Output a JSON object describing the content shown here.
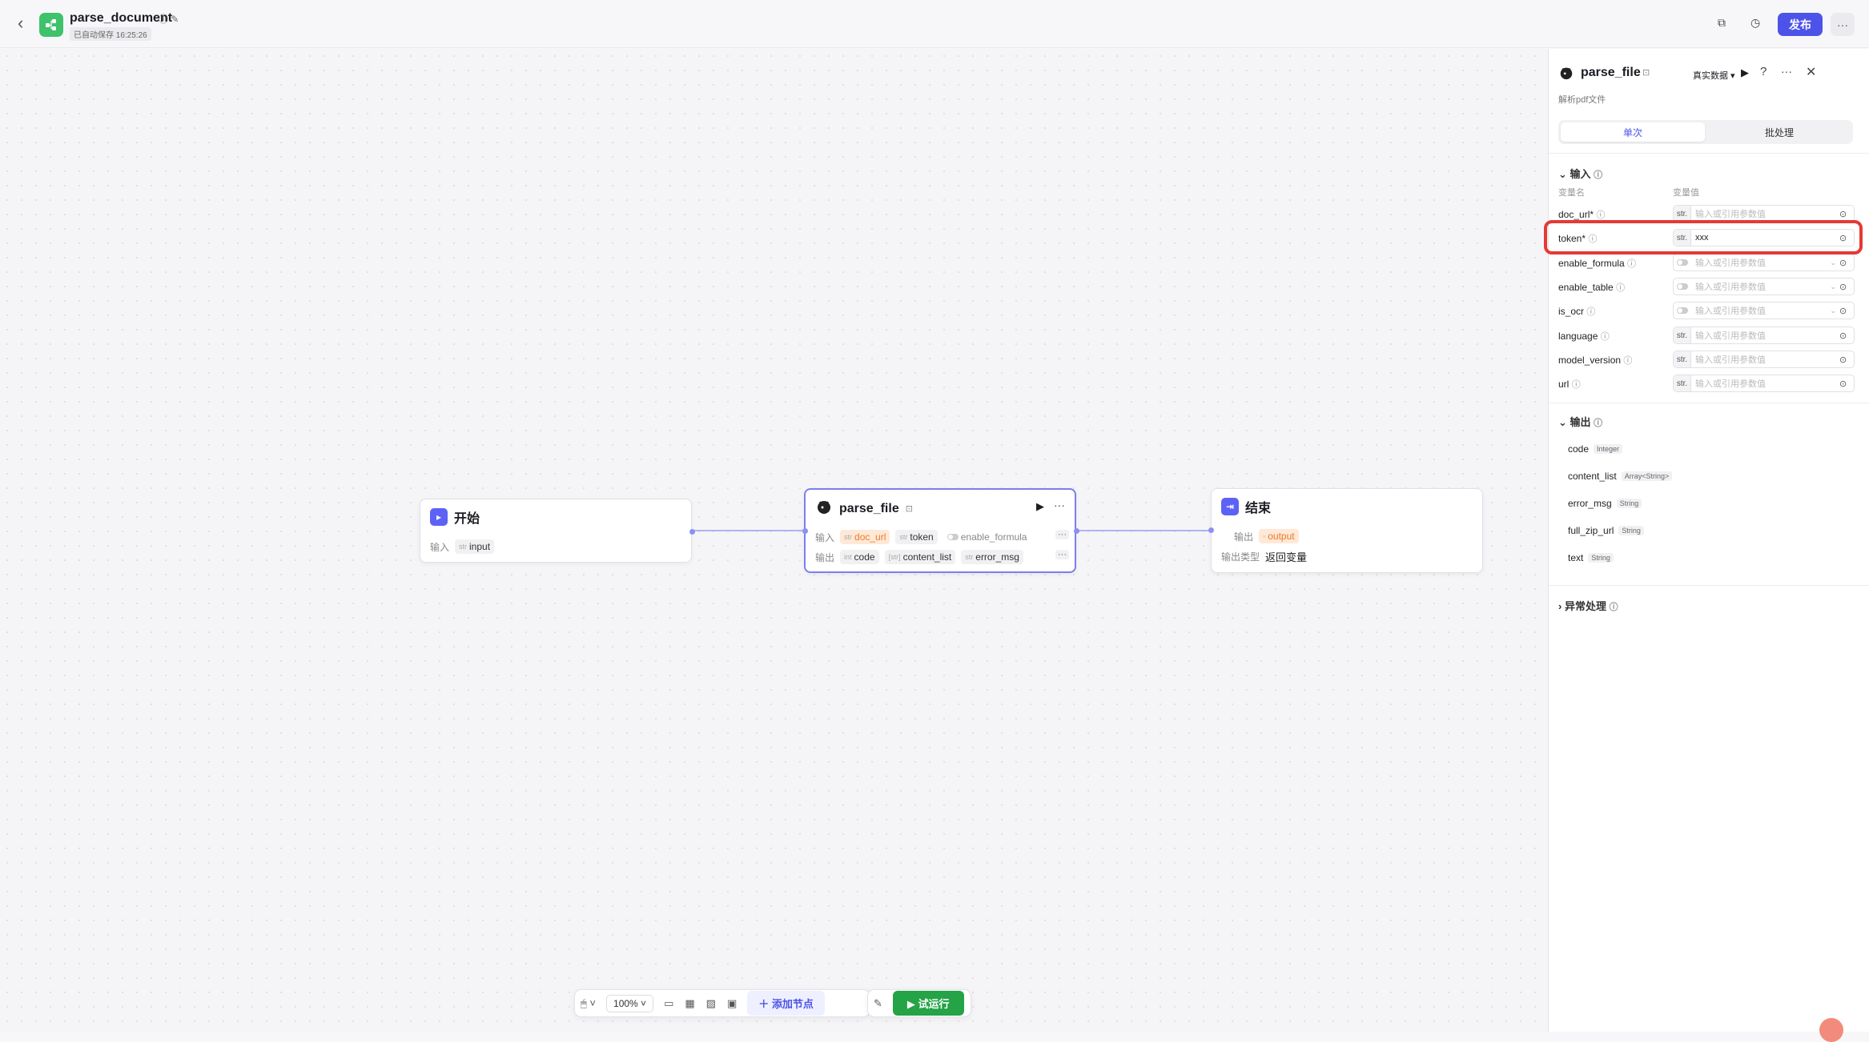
{
  "header": {
    "title": "parse_document",
    "save_status": "已自动保存 16:25:26",
    "publish_label": "发布"
  },
  "canvas": {
    "start_node": {
      "title": "开始",
      "input_label": "输入",
      "input_type": "str",
      "input_value": "input"
    },
    "parse_node": {
      "title": "parse_file",
      "input_label": "输入",
      "inputs": [
        {
          "type": "str",
          "name": "doc_url",
          "style": "orange"
        },
        {
          "type": "str",
          "name": "token",
          "style": "plain"
        },
        {
          "type": "",
          "name": "enable_formula",
          "style": "toggle"
        }
      ],
      "output_label": "输出",
      "outputs": [
        {
          "type": "int",
          "name": "code"
        },
        {
          "type": "[str]",
          "name": "content_list"
        },
        {
          "type": "str",
          "name": "error_msg"
        }
      ]
    },
    "end_node": {
      "title": "结束",
      "output_label": "输出",
      "output_value": "output",
      "output_type_label": "输出类型",
      "output_type_value": "返回变量"
    }
  },
  "toolbar": {
    "zoom": "100%",
    "add_node": "添加节点",
    "test_run": "试运行"
  },
  "panel": {
    "title": "parse_file",
    "data_mode": "真实数据",
    "subtitle": "解析pdf文件",
    "tab_single": "单次",
    "tab_batch": "批处理",
    "input_section": "输入",
    "col_name": "变量名",
    "col_value": "变量值",
    "placeholder": "输入或引用参数值",
    "params": [
      {
        "name": "doc_url",
        "required": true,
        "kind": "str",
        "value": ""
      },
      {
        "name": "token",
        "required": true,
        "kind": "str",
        "value": "xxx"
      },
      {
        "name": "enable_formula",
        "required": false,
        "kind": "bool",
        "value": ""
      },
      {
        "name": "enable_table",
        "required": false,
        "kind": "bool",
        "value": ""
      },
      {
        "name": "is_ocr",
        "required": false,
        "kind": "bool",
        "value": ""
      },
      {
        "name": "language",
        "required": false,
        "kind": "str",
        "value": ""
      },
      {
        "name": "model_version",
        "required": false,
        "kind": "str",
        "value": ""
      },
      {
        "name": "url",
        "required": false,
        "kind": "str",
        "value": ""
      }
    ],
    "output_section": "输出",
    "outputs": [
      {
        "name": "code",
        "type": "Integer"
      },
      {
        "name": "content_list",
        "type": "Array<String>"
      },
      {
        "name": "error_msg",
        "type": "String"
      },
      {
        "name": "full_zip_url",
        "type": "String"
      },
      {
        "name": "text",
        "type": "String"
      }
    ],
    "exception_section": "异常处理"
  }
}
